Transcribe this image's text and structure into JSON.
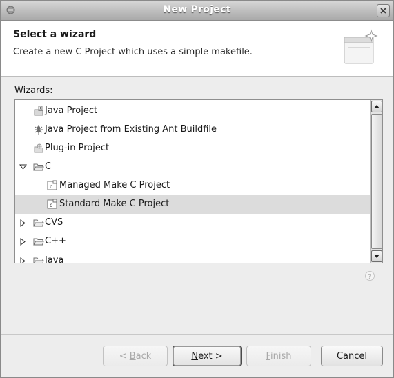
{
  "window": {
    "title": "New Project"
  },
  "header": {
    "title": "Select a wizard",
    "description": "Create a new C Project which uses a simple makefile."
  },
  "wizards": {
    "label_mnemonic": "W",
    "label_rest": "izards:",
    "items": [
      {
        "label": "Java Project",
        "icon": "java-project-icon",
        "expanded": null
      },
      {
        "label": "Java Project from Existing Ant Buildfile",
        "icon": "ant-icon",
        "expanded": null
      },
      {
        "label": "Plug-in Project",
        "icon": "plugin-icon",
        "expanded": null
      },
      {
        "label": "C",
        "icon": "folder-icon",
        "expanded": true
      },
      {
        "label": "Managed Make C Project",
        "icon": "c-project-icon",
        "expanded": null
      },
      {
        "label": "Standard Make C Project",
        "icon": "c-project-icon",
        "expanded": null,
        "selected": true
      },
      {
        "label": "CVS",
        "icon": "folder-icon",
        "expanded": false
      },
      {
        "label": "C++",
        "icon": "folder-icon",
        "expanded": false
      },
      {
        "label": "Java",
        "icon": "folder-icon",
        "expanded": false
      }
    ]
  },
  "buttons": {
    "back_pre": "< ",
    "back_mnemonic": "B",
    "back_rest": "ack",
    "next_mnemonic": "N",
    "next_rest": "ext >",
    "finish_mnemonic": "F",
    "finish_rest": "inish",
    "cancel": "Cancel"
  },
  "colors": {
    "selection": "#dcdcdc",
    "titlebar": "#bdbdbd"
  }
}
